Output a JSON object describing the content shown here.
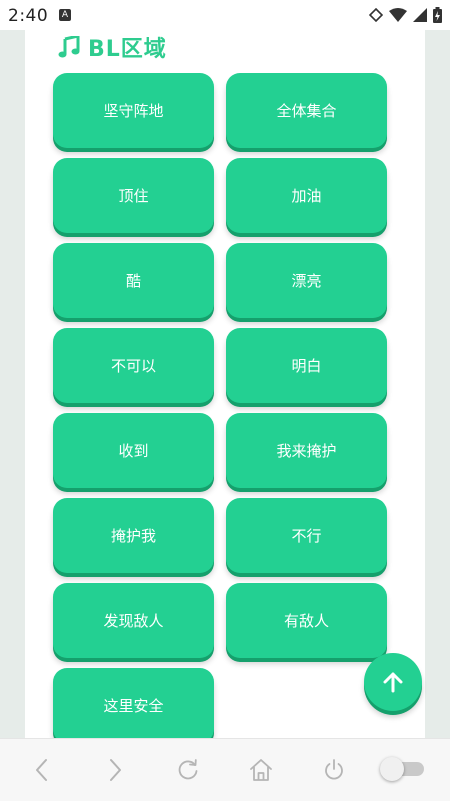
{
  "status_bar": {
    "time": "2:40",
    "notification_icon": "A"
  },
  "section": {
    "title": "BL区域",
    "icon": "music-note-icon",
    "accent_color": "#2ecc8f"
  },
  "buttons": [
    {
      "label": "坚守阵地"
    },
    {
      "label": "全体集合"
    },
    {
      "label": "顶住"
    },
    {
      "label": "加油"
    },
    {
      "label": "酷"
    },
    {
      "label": "漂亮"
    },
    {
      "label": "不可以"
    },
    {
      "label": "明白"
    },
    {
      "label": "收到"
    },
    {
      "label": "我来掩护"
    },
    {
      "label": "掩护我"
    },
    {
      "label": "不行"
    },
    {
      "label": "发现敌人"
    },
    {
      "label": "有敌人"
    },
    {
      "label": "这里安全"
    }
  ],
  "colors": {
    "button": "#23d092",
    "button_shadow": "#15a06c"
  },
  "fab": {
    "icon": "arrow-up-icon"
  },
  "bottom_bar": {
    "items": [
      "back-icon",
      "forward-icon",
      "refresh-icon",
      "home-icon",
      "power-icon",
      "toggle"
    ]
  }
}
